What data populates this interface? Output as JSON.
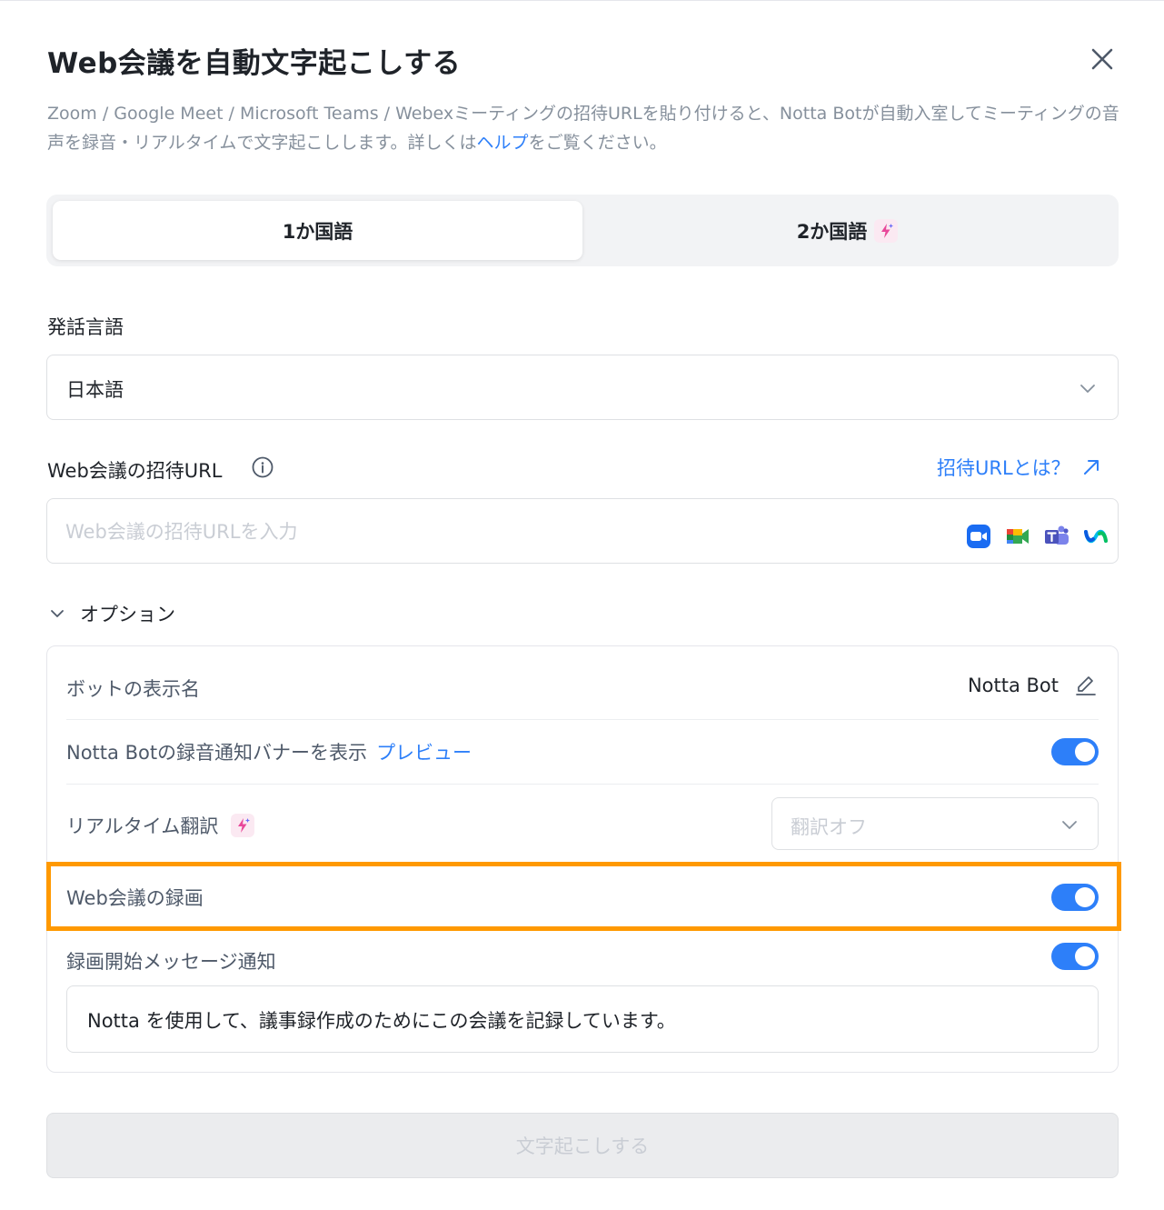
{
  "dialog": {
    "title": "Web会議を自動文字起こしする",
    "description_before_link": "Zoom / Google Meet / Microsoft Teams / Webexミーティングの招待URLを貼り付けると、Notta Botが自動入室してミーティングの音声を録音・リアルタイムで文字起こしします。詳しくは",
    "description_link": "ヘルプ",
    "description_after_link": "をご覧ください。"
  },
  "language_tabs": [
    {
      "label": "1か国語",
      "active": true
    },
    {
      "label": "2か国語",
      "active": false
    }
  ],
  "spoken_language": {
    "label": "発話言語",
    "value": "日本語"
  },
  "invite_url": {
    "label": "Web会議の招待URL",
    "help_link": "招待URLとは？",
    "placeholder": "Web会議の招待URLを入力",
    "app_icons": [
      "zoom-icon",
      "google-meet-icon",
      "microsoft-teams-icon",
      "webex-icon"
    ]
  },
  "options": {
    "toggle_label": "オプション",
    "bot_name_label": "ボットの表示名",
    "bot_name_value": "Notta Bot",
    "banner_label": "Notta Botの録音通知バナーを表示",
    "banner_preview": "プレビュー",
    "banner_enabled": true,
    "translation_label": "リアルタイム翻訳",
    "translation_value": "翻訳オフ",
    "recording_label": "Web会議の録画",
    "recording_enabled": true,
    "start_message_label": "録画開始メッセージ通知",
    "start_message_enabled": true,
    "start_message_text": "Notta を使用して、議事録作成のためにこの会議を記録しています。"
  },
  "submit_label": "文字起こしする",
  "colors": {
    "accent": "#2d7ff9",
    "highlight": "#ff9900"
  }
}
